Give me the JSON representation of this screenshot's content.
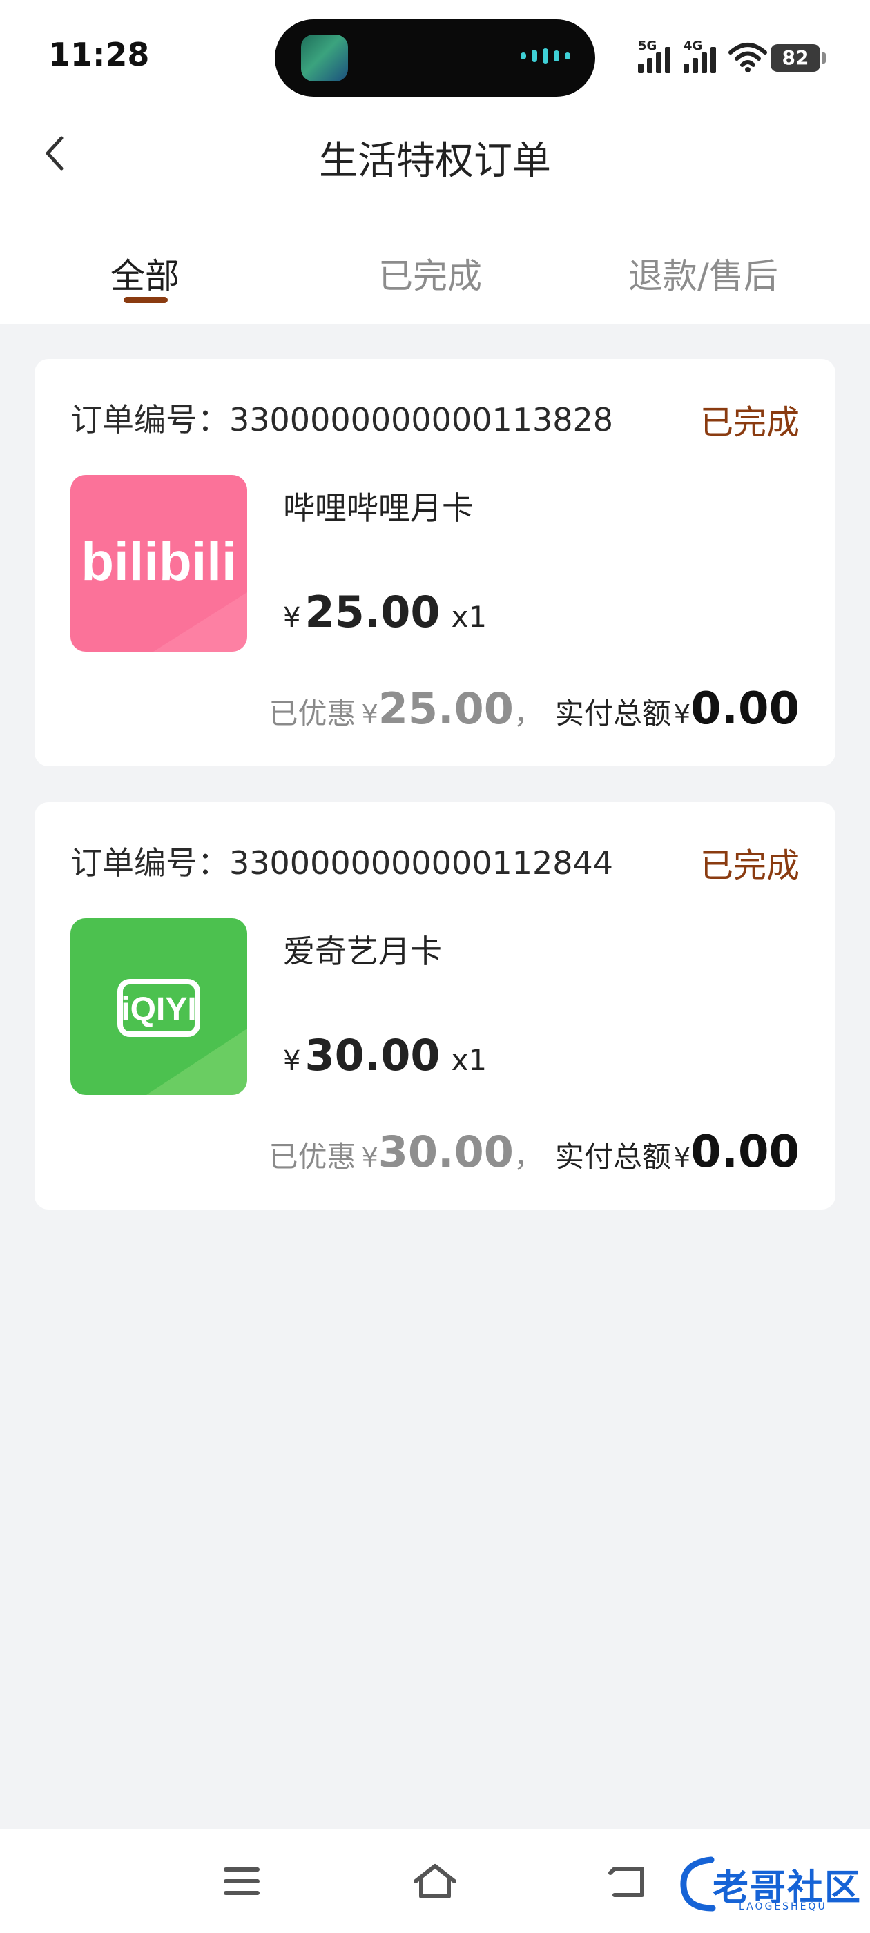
{
  "status_bar": {
    "time": "11:28",
    "network_1": "5G",
    "network_2": "4G",
    "battery": "82"
  },
  "header": {
    "title": "生活特权订单",
    "back_icon": "chevron-left-icon"
  },
  "tabs": [
    {
      "label": "全部",
      "active": true
    },
    {
      "label": "已完成",
      "active": false
    },
    {
      "label": "退款/售后",
      "active": false
    }
  ],
  "orders": [
    {
      "order_label": "订单编号：",
      "order_no": "3300000000000113828",
      "status": "已完成",
      "product_name": "哔哩哔哩月卡",
      "currency": "¥",
      "price": "25.00",
      "qty": "x1",
      "discount_label": "已优惠",
      "discount": "25.00",
      "comma": "，",
      "paid_label": "实付总额",
      "paid": "0.00",
      "thumb_text": "bilibili",
      "thumb_color": "#fb7299"
    },
    {
      "order_label": "订单编号：",
      "order_no": "3300000000000112844",
      "status": "已完成",
      "product_name": "爱奇艺月卡",
      "currency": "¥",
      "price": "30.00",
      "qty": "x1",
      "discount_label": "已优惠",
      "discount": "30.00",
      "comma": "，",
      "paid_label": "实付总额",
      "paid": "0.00",
      "thumb_text": "iQIYI",
      "thumb_color": "#4cc14f"
    }
  ],
  "colors": {
    "accent": "#8a3b10",
    "background": "#f2f3f5"
  },
  "nav": {
    "menu_icon": "menu-icon",
    "home_icon": "home-icon",
    "back_icon": "back-icon"
  },
  "watermark": {
    "text": "老哥社区",
    "sub": "LAOGESHEQU"
  }
}
